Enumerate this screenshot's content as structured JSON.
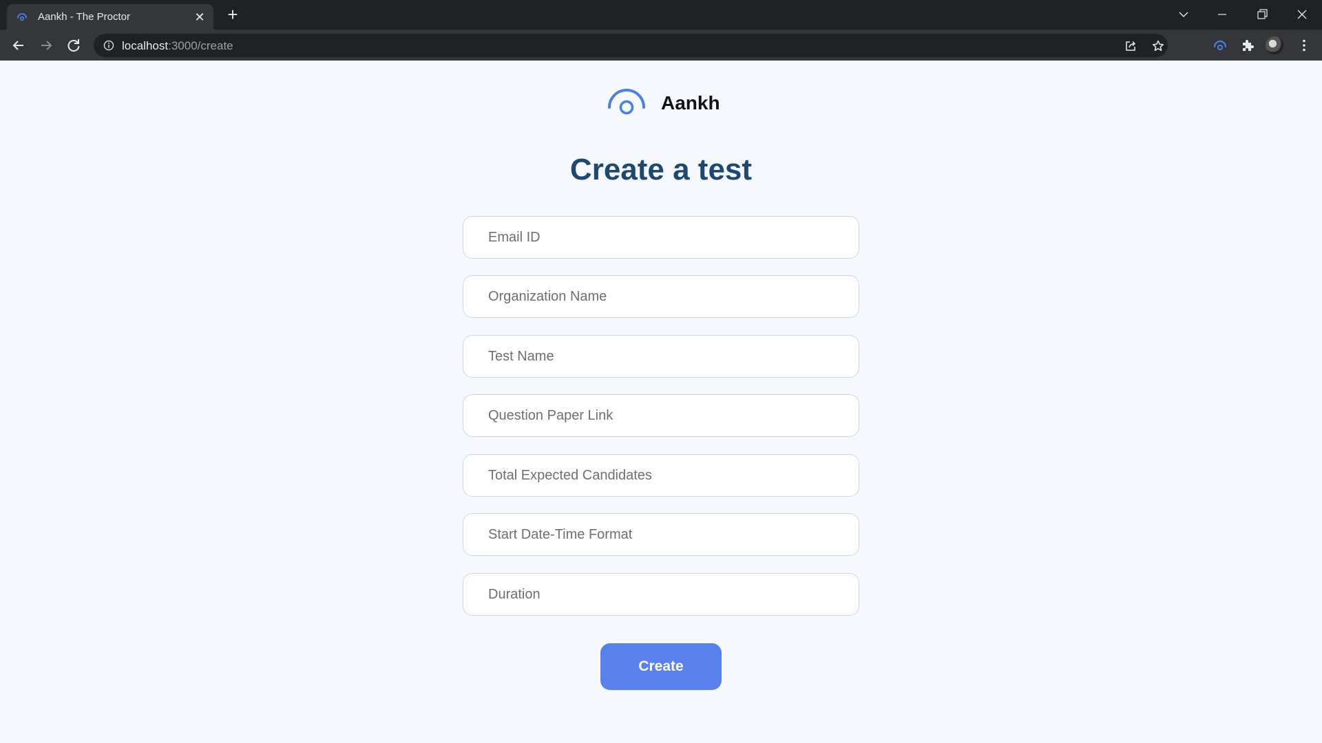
{
  "browser": {
    "tab_title": "Aankh - The Proctor",
    "url_host": "localhost",
    "url_path": ":3000/create",
    "icons": [
      "eye-logo-icon",
      "close-icon",
      "plus-icon",
      "chevron-down-icon",
      "minimize-icon",
      "restore-icon",
      "close-window-icon",
      "back-arrow-icon",
      "forward-arrow-icon",
      "reload-icon",
      "info-icon",
      "share-icon",
      "star-icon",
      "extension-eye-icon",
      "puzzle-icon",
      "avatar",
      "kebab-menu-icon"
    ]
  },
  "brand": {
    "name": "Aankh"
  },
  "page": {
    "title": "Create a test"
  },
  "form": {
    "fields": [
      {
        "placeholder": "Email ID",
        "value": ""
      },
      {
        "placeholder": "Organization Name",
        "value": ""
      },
      {
        "placeholder": "Test Name",
        "value": ""
      },
      {
        "placeholder": "Question Paper Link",
        "value": ""
      },
      {
        "placeholder": "Total Expected Candidates",
        "value": ""
      },
      {
        "placeholder": "Start Date-Time Format",
        "value": ""
      },
      {
        "placeholder": "Duration",
        "value": ""
      }
    ],
    "submit_label": "Create"
  },
  "colors": {
    "accent": "#5a80ec",
    "title": "#1d4870",
    "logo": "#4a7fe6",
    "page_bg": "#f5f9fe"
  }
}
